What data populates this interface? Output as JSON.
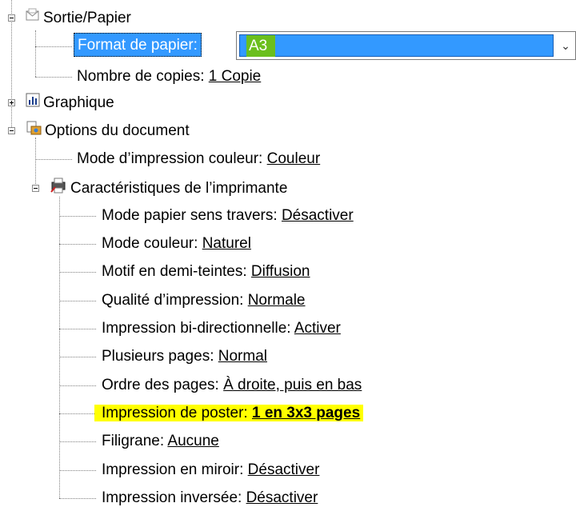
{
  "tree": {
    "sortie": {
      "label": "Sortie/Papier"
    },
    "format": {
      "label": "Format de papier:",
      "value": "A3"
    },
    "copies": {
      "label": "Nombre de copies:",
      "value": "1 Copie"
    },
    "graphique": {
      "label": "Graphique"
    },
    "options": {
      "label": "Options du document"
    },
    "mode_couleur_impr": {
      "label": "Mode d’impression couleur:",
      "value": "Couleur"
    },
    "caracteristiques": {
      "label": "Caractéristiques de l’imprimante"
    },
    "features": [
      {
        "label": "Mode papier sens travers:",
        "value": "Désactiver"
      },
      {
        "label": "Mode couleur:",
        "value": "Naturel"
      },
      {
        "label": "Motif en demi-teintes:",
        "value": "Diffusion"
      },
      {
        "label": "Qualité d’impression:",
        "value": "Normale"
      },
      {
        "label": "Impression bi-directionnelle:",
        "value": "Activer"
      },
      {
        "label": "Plusieurs pages:",
        "value": "Normal"
      },
      {
        "label": "Ordre des pages:",
        "value": "À droite, puis en bas"
      },
      {
        "label": "Impression de poster:",
        "value": "1 en 3x3 pages"
      },
      {
        "label": "Filigrane:",
        "value": "Aucune"
      },
      {
        "label": "Impression en miroir:",
        "value": "Désactiver"
      },
      {
        "label": "Impression inversée:",
        "value": "Désactiver"
      }
    ]
  },
  "colors": {
    "selection": "#3399ff",
    "highlight": "#ffff00",
    "combo_value_bg": "#6bbf1d"
  }
}
